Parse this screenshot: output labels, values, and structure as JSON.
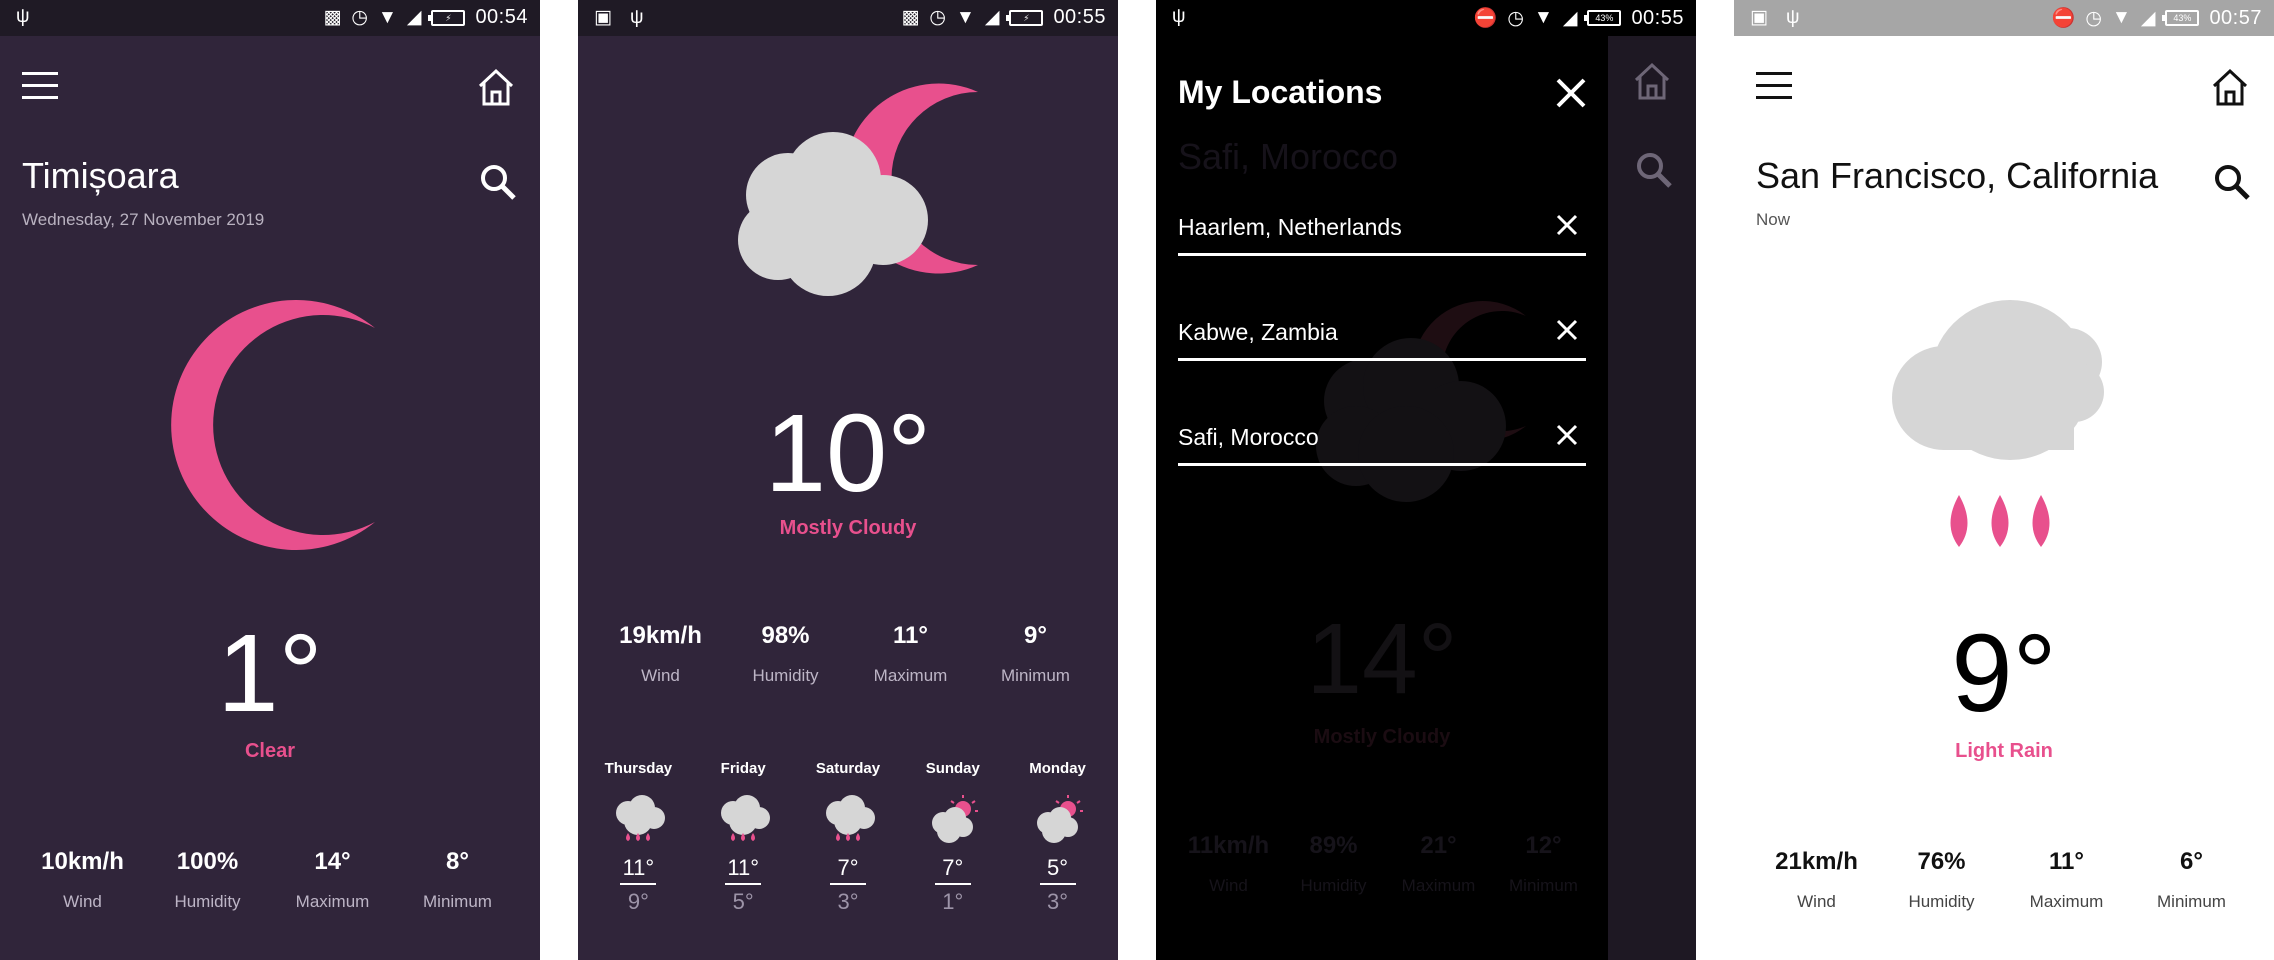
{
  "screens": [
    {
      "status": {
        "time": "00:54"
      },
      "city": "Timișoara",
      "subtitle": "Wednesday, 27 November 2019",
      "temperature": "1°",
      "condition": "Clear",
      "icon": "moon-icon",
      "stats": [
        {
          "value": "10km/h",
          "label": "Wind"
        },
        {
          "value": "100%",
          "label": "Humidity"
        },
        {
          "value": "14°",
          "label": "Maximum"
        },
        {
          "value": "8°",
          "label": "Minimum"
        }
      ]
    },
    {
      "status": {
        "time": "00:55"
      },
      "temperature": "10°",
      "condition": "Mostly Cloudy",
      "icon": "cloud-moon-icon",
      "stats": [
        {
          "value": "19km/h",
          "label": "Wind"
        },
        {
          "value": "98%",
          "label": "Humidity"
        },
        {
          "value": "11°",
          "label": "Maximum"
        },
        {
          "value": "9°",
          "label": "Minimum"
        }
      ],
      "forecast": [
        {
          "day": "Thursday",
          "high": "11°",
          "low": "9°",
          "icon": "rain-icon"
        },
        {
          "day": "Friday",
          "high": "11°",
          "low": "5°",
          "icon": "rain-icon"
        },
        {
          "day": "Saturday",
          "high": "7°",
          "low": "3°",
          "icon": "rain-icon"
        },
        {
          "day": "Sunday",
          "high": "7°",
          "low": "1°",
          "icon": "partly-sunny-icon"
        },
        {
          "day": "Monday",
          "high": "5°",
          "low": "3°",
          "icon": "partly-sunny-icon"
        }
      ]
    },
    {
      "status": {
        "time": "00:55",
        "battery": "43%"
      },
      "drawer_title": "My Locations",
      "background_city": "Safi, Morocco",
      "background_temperature": "14°",
      "background_condition": "Mostly Cloudy",
      "background_stats": [
        {
          "value": "11km/h",
          "label": "Wind"
        },
        {
          "value": "89%",
          "label": "Humidity"
        },
        {
          "value": "21°",
          "label": "Maximum"
        },
        {
          "value": "12°",
          "label": "Minimum"
        }
      ],
      "locations": [
        "Haarlem, Netherlands",
        "Kabwe, Zambia",
        "Safi, Morocco"
      ]
    },
    {
      "status": {
        "time": "00:57",
        "battery": "43%"
      },
      "city": "San Francisco, California",
      "subtitle": "Now",
      "temperature": "9°",
      "condition": "Light Rain",
      "icon": "light-rain-icon",
      "stats": [
        {
          "value": "21km/h",
          "label": "Wind"
        },
        {
          "value": "76%",
          "label": "Humidity"
        },
        {
          "value": "11°",
          "label": "Maximum"
        },
        {
          "value": "6°",
          "label": "Minimum"
        }
      ]
    }
  ],
  "colors": {
    "accent": "#e8508d",
    "dark_bg": "#30253a",
    "cloud": "#d6d6d6"
  }
}
